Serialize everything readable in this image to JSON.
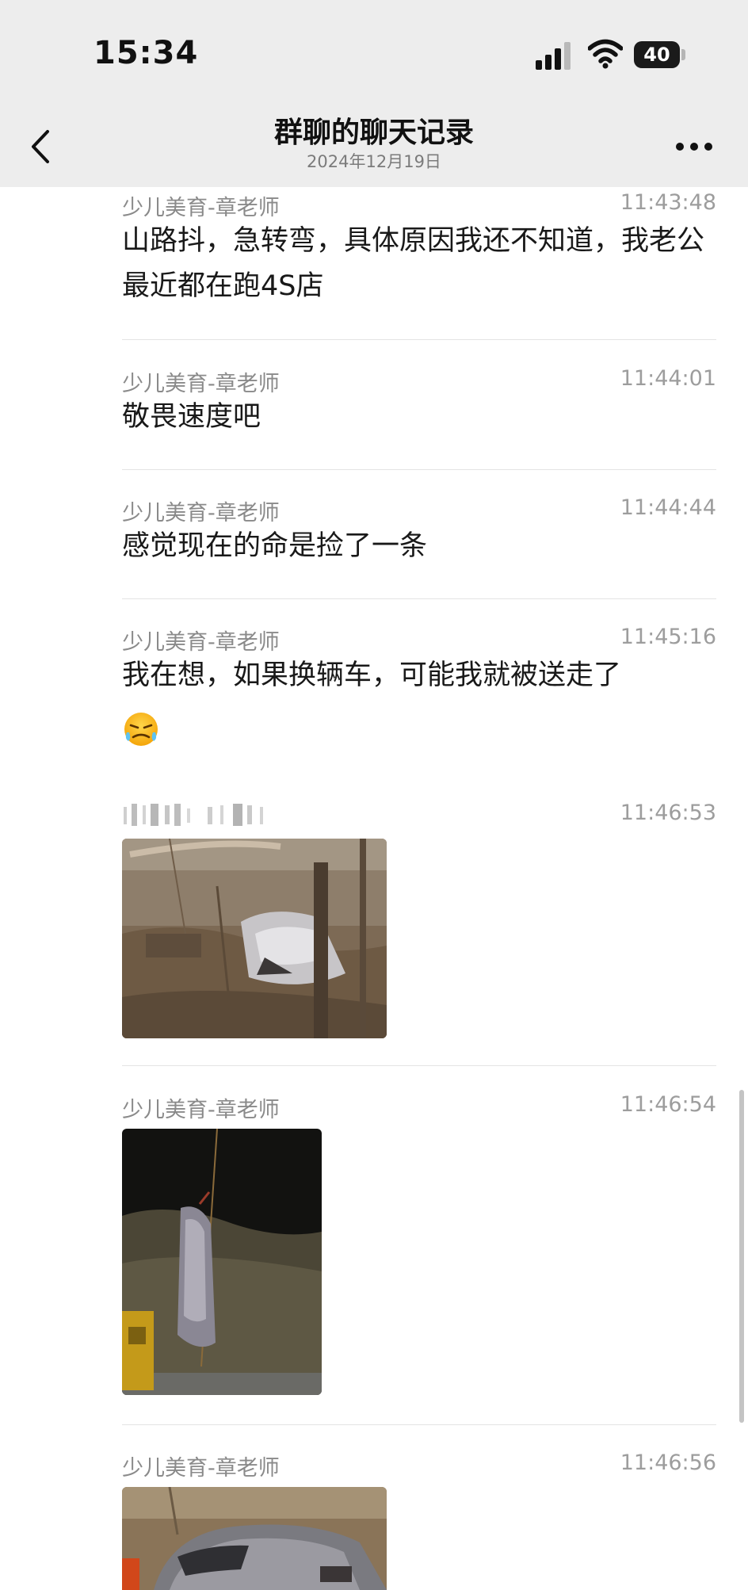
{
  "status_bar": {
    "time": "15:34",
    "battery": "40",
    "icons": [
      "signal-icon",
      "wifi-icon",
      "battery-icon"
    ]
  },
  "nav": {
    "title": "群聊的聊天记录",
    "subtitle": "2024年12月19日",
    "icons": [
      "back-chevron-icon",
      "more-dots-icon"
    ]
  },
  "messages": [
    {
      "sender": "少儿美育-章老师",
      "time": "11:43:48",
      "text": "山路抖，急转弯，具体原因我还不知道，我老公最近都在跑4S店"
    },
    {
      "sender": "少儿美育-章老师",
      "time": "11:44:01",
      "text": "敬畏速度吧"
    },
    {
      "sender": "少儿美育-章老师",
      "time": "11:44:44",
      "text": "感觉现在的命是捡了一条"
    },
    {
      "sender": "少儿美育-章老师",
      "time": "11:45:16",
      "text": "我在想，如果换辆车，可能我就被送走了",
      "emoji": "crying-face-emoji"
    },
    {
      "sender": "",
      "time": "11:46:53",
      "photo": "crashed-car-in-woods-photo"
    },
    {
      "sender": "少儿美育-章老师",
      "time": "11:46:54",
      "photo": "car-lifted-by-crane-photo"
    },
    {
      "sender": "少儿美育-章老师",
      "time": "11:46:56",
      "photo": "damaged-car-closeup-photo"
    }
  ],
  "colors": {
    "header_bg": "#ededed",
    "text": "#191919",
    "meta_text": "#8a8a8a",
    "divider": "#e4e4e4"
  }
}
